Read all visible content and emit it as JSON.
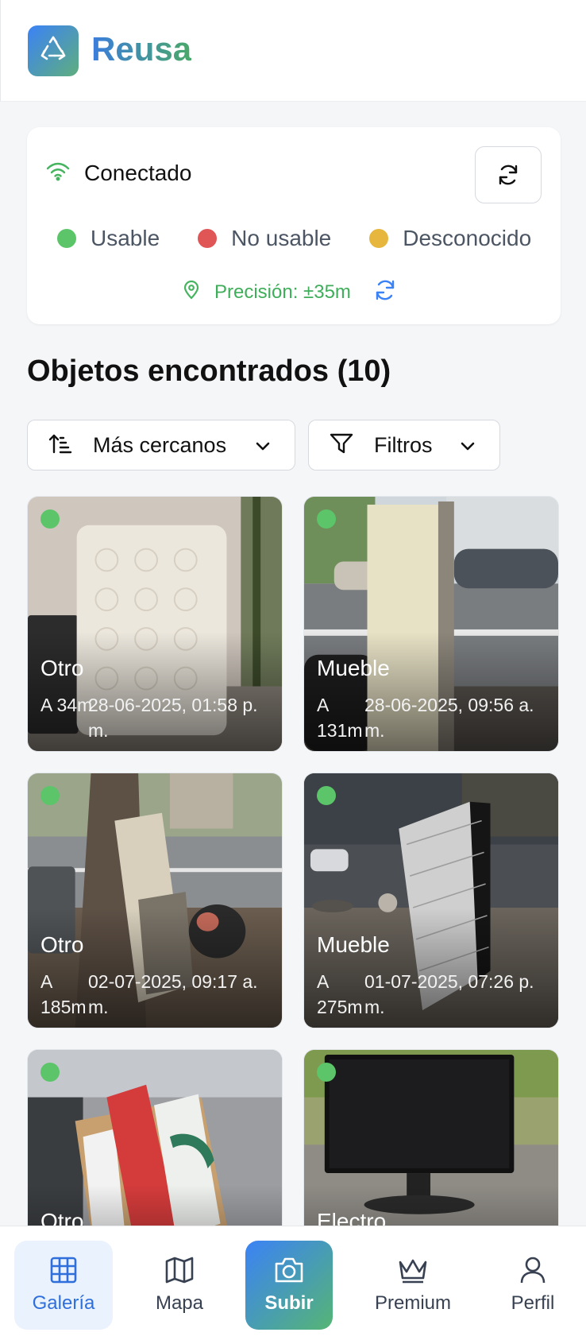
{
  "app": {
    "title": "Reusa"
  },
  "status": {
    "connection_label": "Conectado",
    "legend": [
      {
        "label": "Usable",
        "color": "#5cc56a"
      },
      {
        "label": "No usable",
        "color": "#e05555"
      },
      {
        "label": "Desconocido",
        "color": "#e6b63d"
      }
    ],
    "precision_label": "Precisión: ±35m"
  },
  "results": {
    "title": "Objetos encontrados (10)",
    "sort_label": "Más cercanos",
    "filter_label": "Filtros"
  },
  "items": [
    {
      "category": "Otro",
      "distance": "A 34m",
      "date": "28-06-2025, 01:58 p. m.",
      "status": "usable"
    },
    {
      "category": "Mueble",
      "distance": "A 131m",
      "date": "28-06-2025, 09:56 a. m.",
      "status": "usable"
    },
    {
      "category": "Otro",
      "distance": "A 185m",
      "date": "02-07-2025, 09:17 a. m.",
      "status": "usable"
    },
    {
      "category": "Mueble",
      "distance": "A 275m",
      "date": "01-07-2025, 07:26 p. m.",
      "status": "usable"
    },
    {
      "category": "Otro",
      "distance": "",
      "date": "",
      "status": "usable"
    },
    {
      "category": "Electro",
      "distance": "",
      "date": "",
      "status": "usable"
    }
  ],
  "nav": {
    "items": [
      {
        "label": "Galería",
        "icon": "grid-icon",
        "active": true
      },
      {
        "label": "Mapa",
        "icon": "map-icon"
      },
      {
        "label": "Subir",
        "icon": "camera-icon"
      },
      {
        "label": "Premium",
        "icon": "crown-icon"
      },
      {
        "label": "Perfil",
        "icon": "user-icon"
      }
    ]
  }
}
